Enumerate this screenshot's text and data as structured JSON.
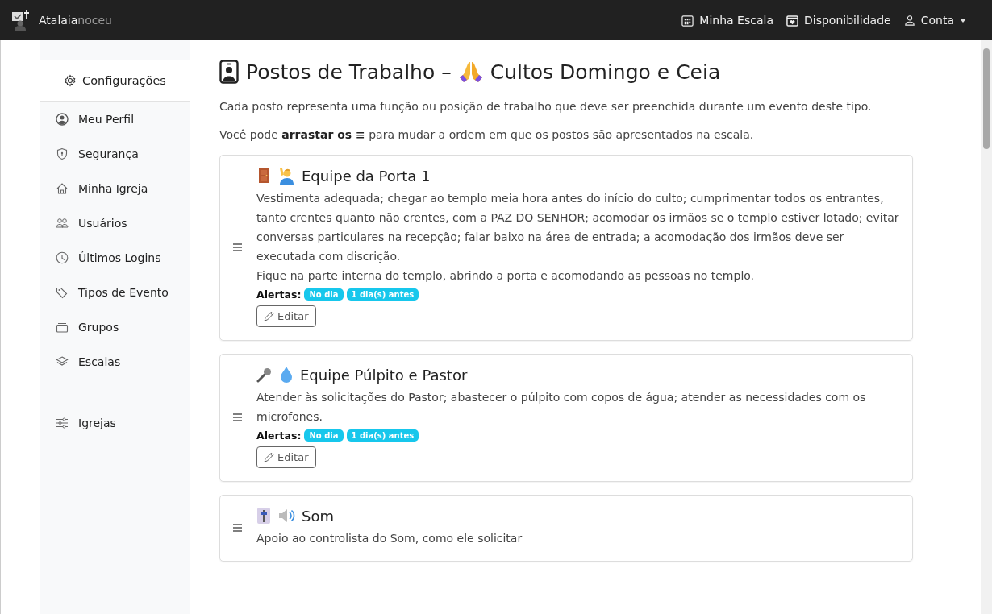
{
  "navbar": {
    "brand_main": "Atalaia",
    "brand_sub": "noceu",
    "links": [
      {
        "kind": "calendar",
        "label": "Minha Escala"
      },
      {
        "kind": "availability",
        "label": "Disponibilidade"
      },
      {
        "kind": "account",
        "label": "Conta",
        "dropdown": true
      }
    ]
  },
  "sidebar": {
    "header": "Configurações",
    "items": [
      {
        "kind": "profile",
        "label": "Meu Perfil",
        "selected": false
      },
      {
        "kind": "shield",
        "label": "Segurança",
        "selected": false
      },
      {
        "kind": "house",
        "label": "Minha Igreja",
        "selected": false
      },
      {
        "kind": "people",
        "label": "Usuários",
        "selected": false
      },
      {
        "kind": "clock",
        "label": "Últimos Logins",
        "selected": false
      },
      {
        "kind": "tags",
        "label": "Tipos de Evento",
        "selected": false
      },
      {
        "kind": "collection",
        "label": "Grupos",
        "selected": false
      },
      {
        "kind": "layers",
        "label": "Escalas",
        "selected": false
      }
    ],
    "footer_items": [
      {
        "kind": "sliders",
        "label": "Igrejas",
        "selected": false
      }
    ]
  },
  "page": {
    "title_before": "Postos de Trabalho –",
    "title_after": "Cultos Domingo e Ceia",
    "intro": "Cada posto representa uma função ou posição de trabalho que deve ser preenchida durante um evento deste tipo.",
    "hint": "Você pode **arrastar os ≡** para mudar a ordem em que os postos são apresentados na escala."
  },
  "posts": [
    {
      "icons": [
        {
          "kind": "door"
        },
        {
          "kind": "person"
        }
      ],
      "title": "Equipe da Porta 1",
      "description": [
        "Vestimenta adequada; chegar ao templo meia hora antes do início do culto; cumprimentar todos os entrantes, tanto crentes quanto não crentes, com a PAZ DO SENHOR; acomodar os irmãos se o templo estiver lotado; evitar conversas particulares na recepção; falar baixo na área de entrada; a acomodação dos irmãos deve ser executada com discrição.",
        "Fique na parte interna do templo, abrindo a porta e acomodando as pessoas no templo."
      ],
      "alerts_label": "Alertas:",
      "alerts": [
        "No dia",
        "1 dia(s) antes"
      ],
      "edit_label": "Editar"
    },
    {
      "icons": [
        {
          "kind": "microphone"
        },
        {
          "kind": "droplet"
        }
      ],
      "title": "Equipe Púlpito e Pastor",
      "description": [
        "Atender às solicitações do Pastor; abastecer o púlpito com copos de água; atender as necessidades com os microfones."
      ],
      "alerts_label": "Alertas:",
      "alerts": [
        "No dia",
        "1 dia(s) antes"
      ],
      "edit_label": "Editar"
    },
    {
      "icons": [
        {
          "kind": "fader"
        },
        {
          "kind": "speaker"
        }
      ],
      "title": "Som",
      "description": [
        "Apoio ao controlista do Som, como ele solicitar"
      ]
    }
  ]
}
